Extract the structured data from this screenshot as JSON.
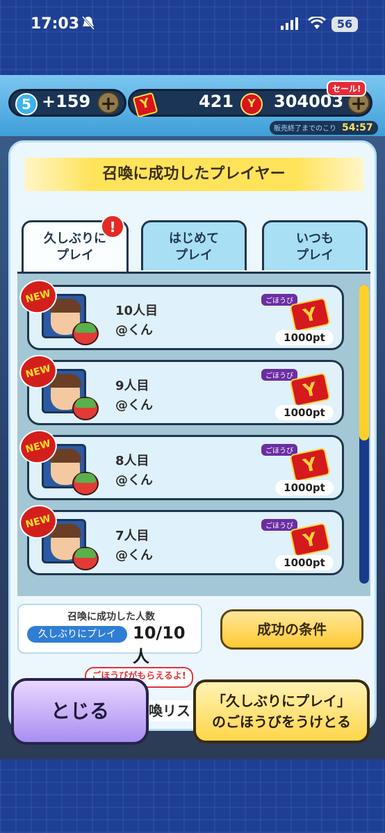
{
  "status_bar": {
    "time": "17:03",
    "battery": "56"
  },
  "top_bar": {
    "level": "5",
    "stamina": "+159",
    "tickets": "421",
    "money": "304003",
    "sale_badge": "セール!",
    "sale_timer_label": "販売終了までのこり",
    "sale_timer_value": "54:57"
  },
  "modal": {
    "title": "召喚に成功したプレイヤー",
    "tabs": [
      {
        "label_line1": "久しぶりに",
        "label_line2": "プレイ",
        "active": true
      },
      {
        "label_line1": "はじめて",
        "label_line2": "プレイ",
        "active": false
      },
      {
        "label_line1": "いつも",
        "label_line2": "プレイ",
        "active": false
      }
    ],
    "tab_alert": "!",
    "reward_tag": "ごほうび",
    "new_badge": "NEW",
    "reward_ticket_icon": "Y",
    "rows": [
      {
        "rank": "10人目",
        "name": "@くん",
        "reward": "1000pt"
      },
      {
        "rank": "9人目",
        "name": "@くん",
        "reward": "1000pt"
      },
      {
        "rank": "8人目",
        "name": "@くん",
        "reward": "1000pt"
      },
      {
        "rank": "7人目",
        "name": "@くん",
        "reward": "1000pt"
      }
    ],
    "scroll_fraction": 0.52,
    "counter_label": "召喚に成功した人数",
    "counter_chip": "久しぶりにプレイ",
    "counter_value": "10/10人",
    "conditions_button": "成功の条件"
  },
  "footer": {
    "close_button": "とじる",
    "claim_button_line1": "「久しぶりにプレイ」",
    "claim_button_line2": "のごほうびをうけとる",
    "behind_pill": "ごほうびがもらえるよ!",
    "behind_text": "喚リス"
  },
  "colors": {
    "background": "#1e3f95",
    "accent_yellow": "#ffd02a",
    "tab_active": "#fbfeff",
    "tab_inactive": "#a8dff5",
    "new_badge": "#d31f1b"
  }
}
